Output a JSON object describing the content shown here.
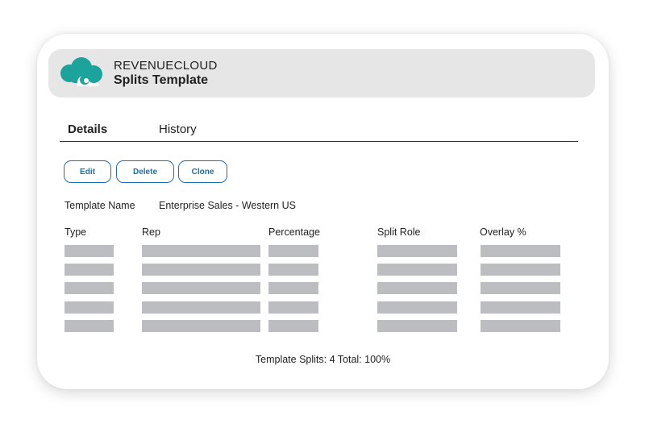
{
  "header": {
    "brand": "REVENUECLOUD",
    "title": "Splits Template"
  },
  "tabs": [
    {
      "label": "Details",
      "active": true
    },
    {
      "label": "History",
      "active": false
    }
  ],
  "actions": {
    "edit": "Edit",
    "delete": "Delete",
    "clone": "Clone"
  },
  "template": {
    "name_label": "Template Name",
    "name_value": "Enterprise Sales - Western US"
  },
  "table": {
    "columns": [
      "Type",
      "Rep",
      "Percentage",
      "Split Role",
      "Overlay %"
    ],
    "row_count": 5
  },
  "summary": "Template Splits: 4 Total: 100%",
  "colors": {
    "logo": "#1ba39c",
    "button_accent": "#1d6fa8",
    "placeholder": "#bcbdc0",
    "header_bg": "#e6e6e6"
  },
  "icons": {
    "logo": "cloud-logo-icon"
  }
}
